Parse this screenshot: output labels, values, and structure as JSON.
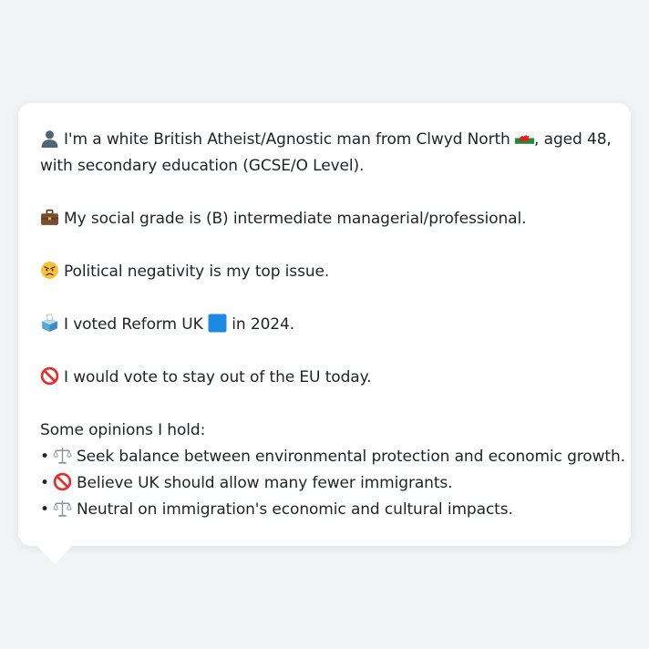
{
  "bubble": {
    "identity": {
      "before_flag": "I'm a white British Atheist/Agnostic man from Clwyd North",
      "after_flag": ", aged 48,",
      "line2": "with secondary education (GCSE/O Level).",
      "icon": "person-silhouette-icon",
      "flag_icon": "wales-flag-icon"
    },
    "social_grade": {
      "text": "My social grade is (B) intermediate managerial/professional.",
      "icon": "briefcase-icon"
    },
    "top_issue": {
      "text": "Political negativity is my top issue.",
      "icon": "angry-face-icon"
    },
    "vote": {
      "before_square": "I voted Reform UK",
      "after_square": " in 2024.",
      "icon": "ballot-box-icon",
      "square_icon": "blue-square-icon",
      "square_color": "#1e88e5"
    },
    "eu": {
      "text": "I would vote to stay out of the EU today.",
      "icon": "no-entry-icon"
    },
    "opinions": {
      "heading": "Some opinions I hold:",
      "bullet": "•",
      "items": [
        {
          "icon": "balance-scale-icon",
          "text": "Seek balance between environmental protection and economic growth."
        },
        {
          "icon": "no-entry-icon",
          "text": "Believe UK should allow many fewer immigrants."
        },
        {
          "icon": "balance-scale-icon",
          "text": "Neutral on immigration's economic and cultural impacts."
        }
      ]
    }
  }
}
